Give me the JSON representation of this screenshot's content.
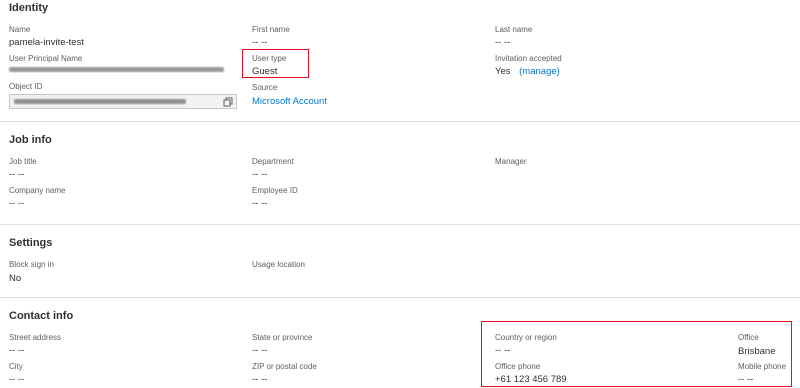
{
  "identity": {
    "title": "Identity",
    "name_label": "Name",
    "name_value": "pamela-invite-test",
    "first_name_label": "First name",
    "first_name_value": "-- --",
    "last_name_label": "Last name",
    "last_name_value": "-- --",
    "upn_label": "User Principal Name",
    "user_type_label": "User type",
    "user_type_value": "Guest",
    "invitation_label": "Invitation accepted",
    "invitation_value": "Yes",
    "manage_link": "(manage)",
    "object_id_label": "Object ID",
    "source_label": "Source",
    "source_value": "Microsoft Account"
  },
  "job_info": {
    "title": "Job info",
    "job_title_label": "Job title",
    "job_title_value": "-- --",
    "department_label": "Department",
    "department_value": "-- --",
    "manager_label": "Manager",
    "company_label": "Company name",
    "company_value": "-- --",
    "employee_id_label": "Employee ID",
    "employee_id_value": "-- --"
  },
  "settings": {
    "title": "Settings",
    "block_label": "Block sign in",
    "block_value": "No",
    "usage_label": "Usage location"
  },
  "contact_info": {
    "title": "Contact info",
    "street_label": "Street address",
    "street_value": "-- --",
    "state_label": "State or province",
    "state_value": "-- --",
    "country_label": "Country or region",
    "country_value": "-- --",
    "office_label": "Office",
    "office_value": "Brisbane",
    "city_label": "City",
    "city_value": "-- --",
    "zip_label": "ZIP or postal code",
    "zip_value": "-- --",
    "office_phone_label": "Office phone",
    "office_phone_value": "+61 123 456 789",
    "mobile_label": "Mobile phone",
    "mobile_value": "-- --"
  },
  "colors": {
    "accent": "#0078d4",
    "highlight": "#e81123"
  },
  "icons": {
    "copy": "copy-icon"
  }
}
